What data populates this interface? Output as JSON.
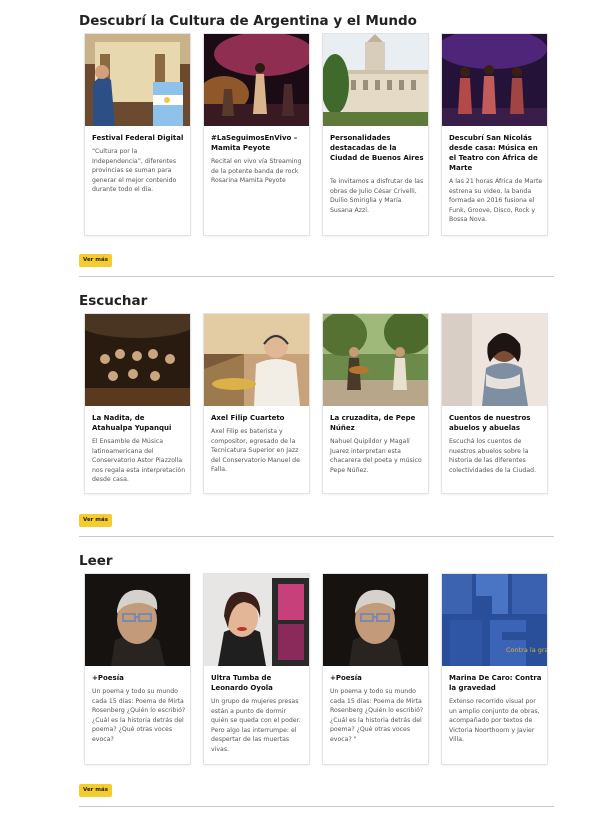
{
  "sections": [
    {
      "title": "Descubrí la Cultura de Argentina y el Mundo",
      "button": "Ver más",
      "cards": [
        {
          "title": "Festival Federal Digital",
          "desc": "“Cultura por la Independencia”, diferentes provincias se suman para generar el mejor contenido durante todo el día."
        },
        {
          "title": "#LaSeguimosEnVivo – Mamita Peyote",
          "desc": "Recital en vivo vía Streaming de la potente banda de rock Rosarina Mamita Peyote"
        },
        {
          "title": "Personalidades destacadas de la Ciudad de Buenos Aires",
          "desc": "Te invitamos a disfrutar de las obras de Julio César Crivelli, Duilio Smiriglia y María Susana Azzi."
        },
        {
          "title": "Descubrí San Nicolás desde casa: Música en el Teatro con África de Marte",
          "desc": "A las 21 horas África de Marte estrena su video, la banda formada en 2016 fusiona el Funk, Groove, Disco, Rock y Bossa Nova."
        }
      ]
    },
    {
      "title": "Escuchar",
      "button": "Ver más",
      "cards": [
        {
          "title": "La Nadita, de Atahualpa Yupanqui",
          "desc": "El Ensamble de Música latinoamericana del Conservatorio Astor Piazzolla nos regala esta interpretación desde casa."
        },
        {
          "title": "Axel Filip Cuarteto",
          "desc": "Axel Filip es baterista y compositor, egresado de la Tecnicatura Superior en Jazz del Conservatorio Manuel de Falla."
        },
        {
          "title": "La cruzadita, de Pepe Núñez",
          "desc": "Nahuel Quipildor y Magalí Juarez interpretan esta chacarera del poeta y músico Pepe Núñez."
        },
        {
          "title": "Cuentos de nuestros abuelos y abuelas",
          "desc": "Escuchá los cuentos de nuestros abuelos sobre la historia de las diferentes colectividades de la Ciudad."
        }
      ]
    },
    {
      "title": "Leer",
      "button": "Ver más",
      "cards": [
        {
          "title": "+Poesía",
          "desc": "Un poema y todo su mundo cada 15 días: Poema de Mirta Rosenberg ¿Quién lo escribió? ¿Cuál es la historia detrás del poema? ¿Qué otras voces evoca?"
        },
        {
          "title": "Ultra Tumba de Leonardo Oyola",
          "desc": "Un grupo de mujeres presas están a punto de dormir quién se queda con el poder. Pero algo las interrumpe: el despertar de las muertas vivas."
        },
        {
          "title": "+Poesía",
          "desc": "Un poema y todo su mundo cada 15 días: Poema de Mirta Rosenberg ¿Quién lo escribió? ¿Cuál es la historia detrás del poema? ¿Qué otras voces evoca? \""
        },
        {
          "title": "Marina De Caro: Contra la gravedad",
          "desc": "Extenso recorrido visual por un amplio conjunto de obras, acompañado por textos de Victoria Noorthoorn y Javier Villa."
        }
      ],
      "cover_text": "Contra la gravedad"
    }
  ]
}
